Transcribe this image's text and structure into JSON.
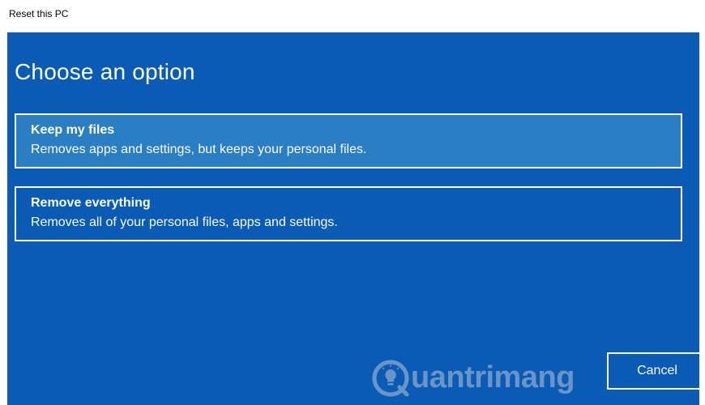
{
  "window": {
    "title": "Reset this PC"
  },
  "panel": {
    "heading": "Choose an option",
    "options": [
      {
        "title": "Keep my files",
        "description": "Removes apps and settings, but keeps your personal files."
      },
      {
        "title": "Remove everything",
        "description": "Removes all of your personal files, apps and settings."
      }
    ],
    "cancel_label": "Cancel"
  },
  "watermark": {
    "text": "uantrimang",
    "logo_icon": "lightbulb-q-logo"
  },
  "colors": {
    "panel_bg": "#0a5bb5",
    "selected_option_bg": "#2a7ec4",
    "text": "#ffffff"
  }
}
